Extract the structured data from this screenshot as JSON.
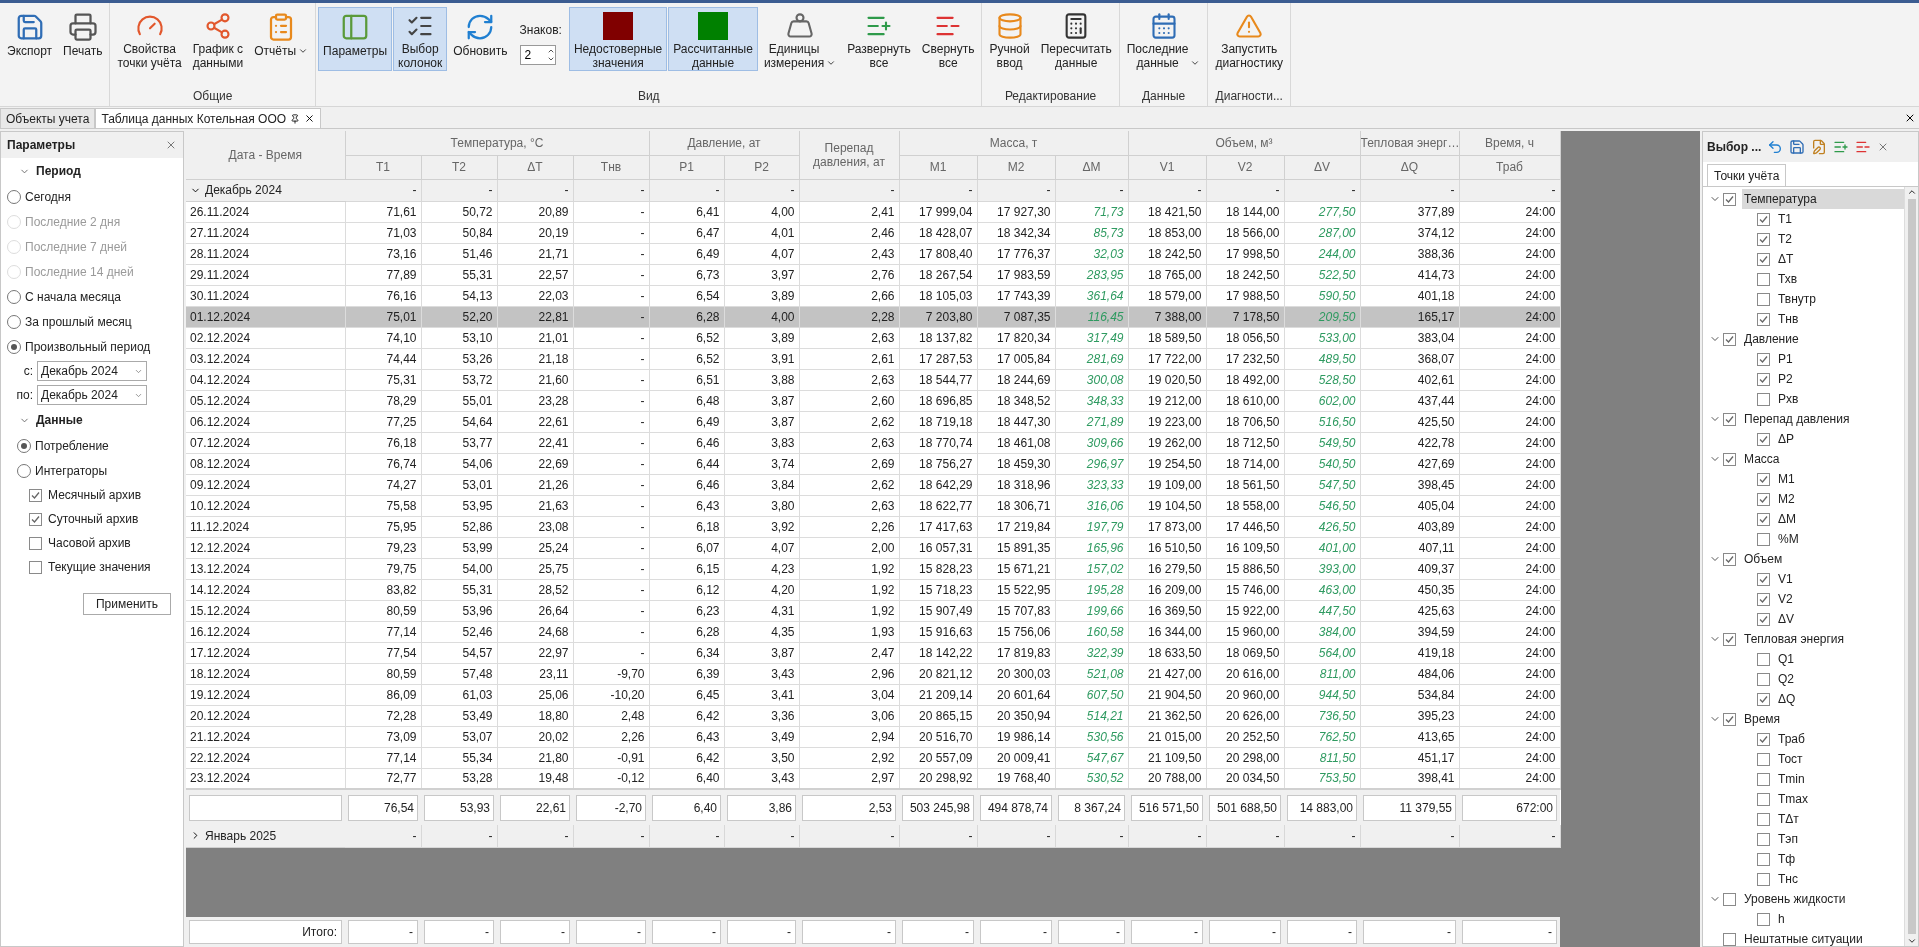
{
  "ribbon": {
    "groups": [
      {
        "items": [
          {
            "kind": "button",
            "label": "Экспорт",
            "selected": false
          },
          {
            "kind": "button",
            "label": "Печать",
            "selected": false
          }
        ]
      },
      {
        "label": "Общие",
        "items": [
          {
            "kind": "button",
            "label": "Свойства\nточки учёта",
            "selected": false
          },
          {
            "kind": "button",
            "label": "График с\nданными",
            "selected": false
          },
          {
            "kind": "button",
            "label": "Отчёты",
            "selected": false,
            "dropdown": true
          }
        ]
      },
      {
        "label": "Вид",
        "items": [
          {
            "kind": "button",
            "label": "Параметры",
            "selected": true
          },
          {
            "kind": "button",
            "label": "Выбор\nколонок",
            "selected": true
          },
          {
            "kind": "button",
            "label": "Обновить",
            "selected": false
          },
          {
            "kind": "spinner",
            "label": "Знаков:",
            "value": "2"
          },
          {
            "kind": "button",
            "label": "Недостоверные\nзначения",
            "selected": true,
            "color": "#800000"
          },
          {
            "kind": "button",
            "label": "Рассчитанные\nданные",
            "selected": true,
            "color": "#008000"
          },
          {
            "kind": "button",
            "label": "Единицы\nизмерения",
            "selected": false,
            "dropdown": true
          },
          {
            "kind": "button",
            "label": "Развернуть\nвсе",
            "selected": false
          },
          {
            "kind": "button",
            "label": "Свернуть\nвсе",
            "selected": false
          }
        ]
      },
      {
        "label": "Редактирование",
        "items": [
          {
            "kind": "button",
            "label": "Ручной\nввод",
            "selected": false
          },
          {
            "kind": "button",
            "label": "Пересчитать\nданные",
            "selected": false
          }
        ]
      },
      {
        "label": "Данные",
        "items": [
          {
            "kind": "button",
            "label": "Последние\nданные",
            "selected": false,
            "dropdown": true
          }
        ]
      },
      {
        "label": "Диагности...",
        "items": [
          {
            "kind": "button",
            "label": "Запустить\nдиагностику",
            "selected": false
          }
        ]
      }
    ]
  },
  "doc_tabs": [
    {
      "label": "Объекты учета",
      "selected": false
    },
    {
      "label": "Таблица данных Котельная ООО",
      "selected": true
    }
  ],
  "parameters": {
    "title": "Параметры",
    "period": {
      "title": "Период",
      "expanded": true,
      "options": [
        {
          "label": "Сегодня",
          "selected": false,
          "disabled": false
        },
        {
          "label": "Последние 2 дня",
          "selected": false,
          "disabled": true
        },
        {
          "label": "Последние 7 дней",
          "selected": false,
          "disabled": true
        },
        {
          "label": "Последние 14 дней",
          "selected": false,
          "disabled": true
        },
        {
          "label": "С начала месяца",
          "selected": false,
          "disabled": false
        },
        {
          "label": "За прошлый месяц",
          "selected": false,
          "disabled": false
        },
        {
          "label": "Произвольный период",
          "selected": true,
          "disabled": false
        }
      ],
      "range": [
        {
          "label": "с:",
          "value": "Декабрь 2024"
        },
        {
          "label": "по:",
          "value": "Декабрь 2024"
        }
      ]
    },
    "data": {
      "title": "Данные",
      "expanded": true,
      "options": [
        {
          "label": "Потребление",
          "selected": true,
          "disabled": false
        },
        {
          "label": "Интеграторы",
          "selected": false,
          "disabled": false
        }
      ],
      "archives": [
        {
          "label": "Месячный архив",
          "checked": true
        },
        {
          "label": "Суточный архив",
          "checked": true
        },
        {
          "label": "Часовой архив",
          "checked": false
        },
        {
          "label": "Текущие значения",
          "checked": false
        }
      ]
    },
    "apply_button": "Применить"
  },
  "table": {
    "header_groups": [
      {
        "label": "Дата - Время"
      },
      {
        "label": "Температура, °C",
        "columns": [
          {
            "label": "T1",
            "kind": "value"
          },
          {
            "label": "T2",
            "kind": "value"
          },
          {
            "label": "ΔT",
            "kind": "value"
          },
          {
            "label": "Тнв",
            "kind": "value"
          }
        ]
      },
      {
        "label": "Давление, ат",
        "columns": [
          {
            "label": "P1",
            "kind": "value"
          },
          {
            "label": "P2",
            "kind": "value"
          }
        ]
      },
      {
        "label": "Перепад давления, ат"
      },
      {
        "label": "Масса, т",
        "columns": [
          {
            "label": "M1",
            "kind": "value"
          },
          {
            "label": "M2",
            "kind": "value"
          },
          {
            "label": "ΔM",
            "kind": "calc"
          }
        ]
      },
      {
        "label": "Объем, м³",
        "columns": [
          {
            "label": "V1",
            "kind": "value"
          },
          {
            "label": "V2",
            "kind": "value"
          },
          {
            "label": "ΔV",
            "kind": "calc"
          }
        ]
      },
      {
        "label": "Тепловая энерг…",
        "columns": [
          {
            "label": "ΔQ",
            "kind": "value"
          }
        ]
      },
      {
        "label": "Время, ч",
        "columns": [
          {
            "label": "Траб",
            "kind": "value"
          }
        ]
      }
    ],
    "groups": [
      {
        "label": "Декабрь 2024",
        "expanded": true,
        "cells": [
          "-",
          "-",
          "-",
          "-",
          "-",
          "-",
          "-",
          "-",
          "-",
          "-",
          "-",
          "-",
          "-",
          "-",
          "-"
        ],
        "rows": [
          {
            "selected": false,
            "cells": [
              "26.11.2024",
              "71,61",
              "50,72",
              "20,89",
              "-",
              "6,41",
              "4,00",
              "2,41",
              "17 999,04",
              "17 927,30",
              "71,73",
              "18 421,50",
              "18 144,00",
              "277,50",
              "377,89",
              "24:00"
            ]
          },
          {
            "selected": false,
            "cells": [
              "27.11.2024",
              "71,03",
              "50,84",
              "20,19",
              "-",
              "6,47",
              "4,01",
              "2,46",
              "18 428,07",
              "18 342,34",
              "85,73",
              "18 853,00",
              "18 566,00",
              "287,00",
              "374,12",
              "24:00"
            ]
          },
          {
            "selected": false,
            "cells": [
              "28.11.2024",
              "73,16",
              "51,46",
              "21,71",
              "-",
              "6,49",
              "4,07",
              "2,43",
              "17 808,40",
              "17 776,37",
              "32,03",
              "18 242,50",
              "17 998,50",
              "244,00",
              "388,36",
              "24:00"
            ]
          },
          {
            "selected": false,
            "cells": [
              "29.11.2024",
              "77,89",
              "55,31",
              "22,57",
              "-",
              "6,73",
              "3,97",
              "2,76",
              "18 267,54",
              "17 983,59",
              "283,95",
              "18 765,00",
              "18 242,50",
              "522,50",
              "414,73",
              "24:00"
            ]
          },
          {
            "selected": false,
            "cells": [
              "30.11.2024",
              "76,16",
              "54,13",
              "22,03",
              "-",
              "6,54",
              "3,89",
              "2,66",
              "18 105,03",
              "17 743,39",
              "361,64",
              "18 579,00",
              "17 988,50",
              "590,50",
              "401,18",
              "24:00"
            ]
          },
          {
            "selected": true,
            "cells": [
              "01.12.2024",
              "75,01",
              "52,20",
              "22,81",
              "-",
              "6,28",
              "4,00",
              "2,28",
              "7 203,80",
              "7 087,35",
              "116,45",
              "7 388,00",
              "7 178,50",
              "209,50",
              "165,17",
              "24:00"
            ]
          },
          {
            "selected": false,
            "cells": [
              "02.12.2024",
              "74,10",
              "53,10",
              "21,01",
              "-",
              "6,52",
              "3,89",
              "2,63",
              "18 137,82",
              "17 820,34",
              "317,49",
              "18 589,50",
              "18 056,50",
              "533,00",
              "383,04",
              "24:00"
            ]
          },
          {
            "selected": false,
            "cells": [
              "03.12.2024",
              "74,44",
              "53,26",
              "21,18",
              "-",
              "6,52",
              "3,91",
              "2,61",
              "17 287,53",
              "17 005,84",
              "281,69",
              "17 722,00",
              "17 232,50",
              "489,50",
              "368,07",
              "24:00"
            ]
          },
          {
            "selected": false,
            "cells": [
              "04.12.2024",
              "75,31",
              "53,72",
              "21,60",
              "-",
              "6,51",
              "3,88",
              "2,63",
              "18 544,77",
              "18 244,69",
              "300,08",
              "19 020,50",
              "18 492,00",
              "528,50",
              "402,61",
              "24:00"
            ]
          },
          {
            "selected": false,
            "cells": [
              "05.12.2024",
              "78,29",
              "55,01",
              "23,28",
              "-",
              "6,48",
              "3,87",
              "2,60",
              "18 696,85",
              "18 348,52",
              "348,33",
              "19 212,00",
              "18 610,00",
              "602,00",
              "437,44",
              "24:00"
            ]
          },
          {
            "selected": false,
            "cells": [
              "06.12.2024",
              "77,25",
              "54,64",
              "22,61",
              "-",
              "6,49",
              "3,87",
              "2,62",
              "18 719,18",
              "18 447,30",
              "271,89",
              "19 223,00",
              "18 706,50",
              "516,50",
              "425,50",
              "24:00"
            ]
          },
          {
            "selected": false,
            "cells": [
              "07.12.2024",
              "76,18",
              "53,77",
              "22,41",
              "-",
              "6,46",
              "3,83",
              "2,63",
              "18 770,74",
              "18 461,08",
              "309,66",
              "19 262,00",
              "18 712,50",
              "549,50",
              "422,78",
              "24:00"
            ]
          },
          {
            "selected": false,
            "cells": [
              "08.12.2024",
              "76,74",
              "54,06",
              "22,69",
              "-",
              "6,44",
              "3,74",
              "2,69",
              "18 756,27",
              "18 459,30",
              "296,97",
              "19 254,50",
              "18 714,00",
              "540,50",
              "427,69",
              "24:00"
            ]
          },
          {
            "selected": false,
            "cells": [
              "09.12.2024",
              "74,27",
              "53,01",
              "21,26",
              "-",
              "6,46",
              "3,84",
              "2,62",
              "18 642,29",
              "18 318,96",
              "323,33",
              "19 109,00",
              "18 561,50",
              "547,50",
              "398,45",
              "24:00"
            ]
          },
          {
            "selected": false,
            "cells": [
              "10.12.2024",
              "75,58",
              "53,95",
              "21,63",
              "-",
              "6,43",
              "3,80",
              "2,63",
              "18 622,77",
              "18 306,71",
              "316,06",
              "19 104,50",
              "18 558,00",
              "546,50",
              "405,04",
              "24:00"
            ]
          },
          {
            "selected": false,
            "cells": [
              "11.12.2024",
              "75,95",
              "52,86",
              "23,08",
              "-",
              "6,18",
              "3,92",
              "2,26",
              "17 417,63",
              "17 219,84",
              "197,79",
              "17 873,00",
              "17 446,50",
              "426,50",
              "403,89",
              "24:00"
            ]
          },
          {
            "selected": false,
            "cells": [
              "12.12.2024",
              "79,23",
              "53,99",
              "25,24",
              "-",
              "6,07",
              "4,07",
              "2,00",
              "16 057,31",
              "15 891,35",
              "165,96",
              "16 510,50",
              "16 109,50",
              "401,00",
              "407,11",
              "24:00"
            ]
          },
          {
            "selected": false,
            "cells": [
              "13.12.2024",
              "79,75",
              "54,00",
              "25,75",
              "-",
              "6,15",
              "4,23",
              "1,92",
              "15 828,23",
              "15 671,21",
              "157,02",
              "16 279,50",
              "15 886,50",
              "393,00",
              "409,37",
              "24:00"
            ]
          },
          {
            "selected": false,
            "cells": [
              "14.12.2024",
              "83,82",
              "55,31",
              "28,52",
              "-",
              "6,12",
              "4,20",
              "1,92",
              "15 718,23",
              "15 522,95",
              "195,28",
              "16 209,00",
              "15 746,00",
              "463,00",
              "450,35",
              "24:00"
            ]
          },
          {
            "selected": false,
            "cells": [
              "15.12.2024",
              "80,59",
              "53,96",
              "26,64",
              "-",
              "6,23",
              "4,31",
              "1,92",
              "15 907,49",
              "15 707,83",
              "199,66",
              "16 369,50",
              "15 922,00",
              "447,50",
              "425,63",
              "24:00"
            ]
          },
          {
            "selected": false,
            "cells": [
              "16.12.2024",
              "77,14",
              "52,46",
              "24,68",
              "-",
              "6,28",
              "4,35",
              "1,93",
              "15 916,63",
              "15 756,06",
              "160,58",
              "16 344,00",
              "15 960,00",
              "384,00",
              "394,59",
              "24:00"
            ]
          },
          {
            "selected": false,
            "cells": [
              "17.12.2024",
              "77,54",
              "54,57",
              "22,97",
              "-",
              "6,34",
              "3,87",
              "2,47",
              "18 142,22",
              "17 819,83",
              "322,39",
              "18 633,50",
              "18 069,50",
              "564,00",
              "419,18",
              "24:00"
            ]
          },
          {
            "selected": false,
            "cells": [
              "18.12.2024",
              "80,59",
              "57,48",
              "23,11",
              "-9,70",
              "6,39",
              "3,43",
              "2,96",
              "20 821,12",
              "20 300,03",
              "521,08",
              "21 427,00",
              "20 616,00",
              "811,00",
              "484,06",
              "24:00"
            ]
          },
          {
            "selected": false,
            "cells": [
              "19.12.2024",
              "86,09",
              "61,03",
              "25,06",
              "-10,20",
              "6,45",
              "3,41",
              "3,04",
              "21 209,14",
              "20 601,64",
              "607,50",
              "21 904,50",
              "20 960,00",
              "944,50",
              "534,84",
              "24:00"
            ]
          },
          {
            "selected": false,
            "cells": [
              "20.12.2024",
              "72,28",
              "53,49",
              "18,80",
              "2,48",
              "6,42",
              "3,36",
              "3,06",
              "20 865,15",
              "20 350,94",
              "514,21",
              "21 362,50",
              "20 626,00",
              "736,50",
              "395,23",
              "24:00"
            ]
          },
          {
            "selected": false,
            "cells": [
              "21.12.2024",
              "73,09",
              "53,07",
              "20,02",
              "2,26",
              "6,43",
              "3,49",
              "2,94",
              "20 516,70",
              "19 986,14",
              "530,56",
              "21 015,00",
              "20 252,50",
              "762,50",
              "413,65",
              "24:00"
            ]
          },
          {
            "selected": false,
            "cells": [
              "22.12.2024",
              "77,14",
              "55,34",
              "21,80",
              "-0,91",
              "6,42",
              "3,50",
              "2,92",
              "20 557,09",
              "20 009,41",
              "547,67",
              "21 109,50",
              "20 298,00",
              "811,50",
              "451,17",
              "24:00"
            ]
          },
          {
            "selected": false,
            "cells": [
              "23.12.2024",
              "72,77",
              "53,28",
              "19,48",
              "-0,12",
              "6,40",
              "3,43",
              "2,97",
              "20 298,92",
              "19 768,40",
              "530,52",
              "20 788,00",
              "20 034,50",
              "753,50",
              "398,41",
              "24:00"
            ]
          }
        ],
        "summary": [
          "76,54",
          "53,93",
          "22,61",
          "-2,70",
          "6,40",
          "3,86",
          "2,53",
          "503 245,98",
          "494 878,74",
          "8 367,24",
          "516 571,50",
          "501 688,50",
          "14 883,00",
          "11 379,55",
          "672:00"
        ]
      },
      {
        "label": "Январь 2025",
        "expanded": false,
        "cells": [
          "-",
          "-",
          "-",
          "-",
          "-",
          "-",
          "-",
          "-",
          "-",
          "-",
          "-",
          "-",
          "-",
          "-",
          "-"
        ]
      }
    ],
    "totals": {
      "label": "Итого:",
      "cells": [
        "-",
        "-",
        "-",
        "-",
        "-",
        "-",
        "-",
        "-",
        "-",
        "-",
        "-",
        "-",
        "-",
        "-",
        "-"
      ]
    }
  },
  "column_chooser": {
    "title": "Выбор ...",
    "tab": "Точки учёта",
    "tree": [
      {
        "label": "Температура",
        "checked": true,
        "selected": true,
        "expanded": true,
        "children": [
          {
            "label": "T1",
            "checked": true,
            "selected": false
          },
          {
            "label": "T2",
            "checked": true,
            "selected": false
          },
          {
            "label": "ΔT",
            "checked": true,
            "selected": false
          },
          {
            "label": "Тхв",
            "checked": false,
            "selected": false
          },
          {
            "label": "Твнутр",
            "checked": false,
            "selected": false
          },
          {
            "label": "Тнв",
            "checked": true,
            "selected": false
          }
        ]
      },
      {
        "label": "Давление",
        "checked": true,
        "selected": false,
        "expanded": true,
        "children": [
          {
            "label": "P1",
            "checked": true,
            "selected": false
          },
          {
            "label": "P2",
            "checked": true,
            "selected": false
          },
          {
            "label": "Рхв",
            "checked": false,
            "selected": false
          }
        ]
      },
      {
        "label": "Перепад давления",
        "checked": true,
        "selected": false,
        "expanded": true,
        "children": [
          {
            "label": "ΔP",
            "checked": true,
            "selected": false
          }
        ]
      },
      {
        "label": "Масса",
        "checked": true,
        "selected": false,
        "expanded": true,
        "children": [
          {
            "label": "M1",
            "checked": true,
            "selected": false
          },
          {
            "label": "M2",
            "checked": true,
            "selected": false
          },
          {
            "label": "ΔM",
            "checked": true,
            "selected": false
          },
          {
            "label": "%M",
            "checked": false,
            "selected": false
          }
        ]
      },
      {
        "label": "Объем",
        "checked": true,
        "selected": false,
        "expanded": true,
        "children": [
          {
            "label": "V1",
            "checked": true,
            "selected": false
          },
          {
            "label": "V2",
            "checked": true,
            "selected": false
          },
          {
            "label": "ΔV",
            "checked": true,
            "selected": false
          }
        ]
      },
      {
        "label": "Тепловая энергия",
        "checked": true,
        "selected": false,
        "expanded": true,
        "children": [
          {
            "label": "Q1",
            "checked": false,
            "selected": false
          },
          {
            "label": "Q2",
            "checked": false,
            "selected": false
          },
          {
            "label": "ΔQ",
            "checked": true,
            "selected": false
          }
        ]
      },
      {
        "label": "Время",
        "checked": true,
        "selected": false,
        "expanded": true,
        "children": [
          {
            "label": "Траб",
            "checked": true,
            "selected": false
          },
          {
            "label": "Тост",
            "checked": false,
            "selected": false
          },
          {
            "label": "Tmin",
            "checked": false,
            "selected": false
          },
          {
            "label": "Tmax",
            "checked": false,
            "selected": false
          },
          {
            "label": "TΔт",
            "checked": false,
            "selected": false
          },
          {
            "label": "Тэп",
            "checked": false,
            "selected": false
          },
          {
            "label": "Тф",
            "checked": false,
            "selected": false
          },
          {
            "label": "Тнс",
            "checked": false,
            "selected": false
          }
        ]
      },
      {
        "label": "Уровень жидкости",
        "checked": false,
        "selected": false,
        "expanded": true,
        "children": [
          {
            "label": "h",
            "checked": false,
            "selected": false
          }
        ]
      },
      {
        "label": "Нештатные ситуации",
        "checked": false,
        "selected": false
      }
    ]
  }
}
